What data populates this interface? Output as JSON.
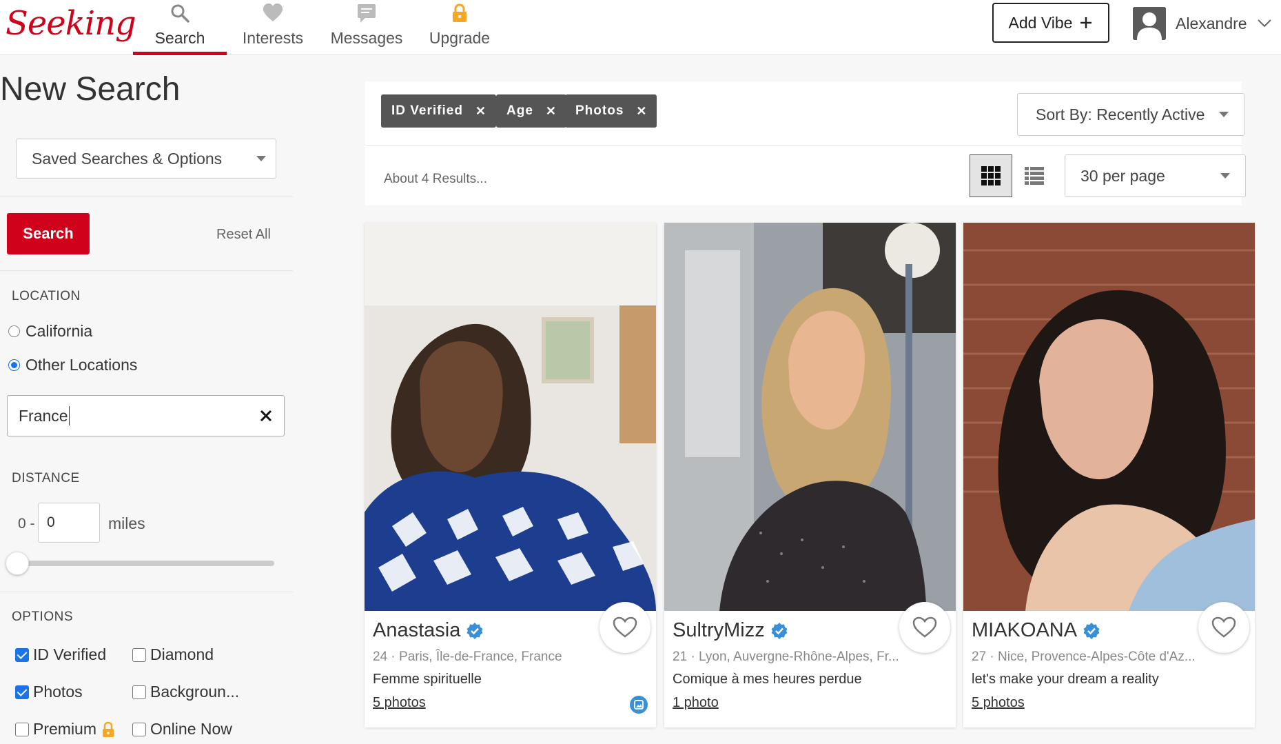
{
  "brand": {
    "logo_text": "Seeking",
    "accent": "#d0021b",
    "link_blue": "#1a73e8"
  },
  "nav": {
    "items": [
      {
        "label": "Search",
        "icon": "search-icon",
        "active": true
      },
      {
        "label": "Interests",
        "icon": "heart-icon",
        "active": false
      },
      {
        "label": "Messages",
        "icon": "message-icon",
        "active": false
      },
      {
        "label": "Upgrade",
        "icon": "lock-icon",
        "active": false
      }
    ],
    "add_vibe": "Add Vibe",
    "user_name": "Alexandre"
  },
  "sidebar": {
    "title": "New Search",
    "saved_searches": "Saved Searches & Options",
    "search_button": "Search",
    "reset_all": "Reset All",
    "location": {
      "title": "LOCATION",
      "options": [
        {
          "label": "California",
          "selected": false
        },
        {
          "label": "Other Locations",
          "selected": true
        }
      ],
      "value": "France"
    },
    "distance": {
      "title": "DISTANCE",
      "prefix": "0 -",
      "value": "0",
      "unit": "miles"
    },
    "options": {
      "title": "OPTIONS",
      "items": [
        {
          "label": "ID Verified",
          "checked": true
        },
        {
          "label": "Diamond",
          "checked": false
        },
        {
          "label": "Photos",
          "checked": true
        },
        {
          "label": "Backgroun...",
          "checked": false
        },
        {
          "label": "Premium",
          "checked": false
        },
        {
          "label": "Online Now",
          "checked": false
        }
      ]
    }
  },
  "main": {
    "filters": [
      "ID Verified",
      "Age",
      "Photos"
    ],
    "sort_label": "Sort By: Recently Active",
    "results_text": "About 4 Results...",
    "per_page": "30 per page",
    "view_mode": "grid"
  },
  "cards": [
    {
      "name": "Anastasia",
      "meta": "24 · Paris, Île-de-France, France",
      "tagline": "Femme spirituelle",
      "photos": "5 photos",
      "verified": true,
      "has_badge": true
    },
    {
      "name": "SultryMizz",
      "meta": "21 · Lyon, Auvergne-Rhône-Alpes, Fr...",
      "tagline": "Comique à mes heures perdue",
      "photos": "1 photo",
      "verified": true,
      "has_badge": false
    },
    {
      "name": "MIAKOANA",
      "meta": "27 · Nice, Provence-Alpes-Côte d'Az...",
      "tagline": "let's make your dream a reality",
      "photos": "5 photos",
      "verified": true,
      "has_badge": false
    }
  ]
}
